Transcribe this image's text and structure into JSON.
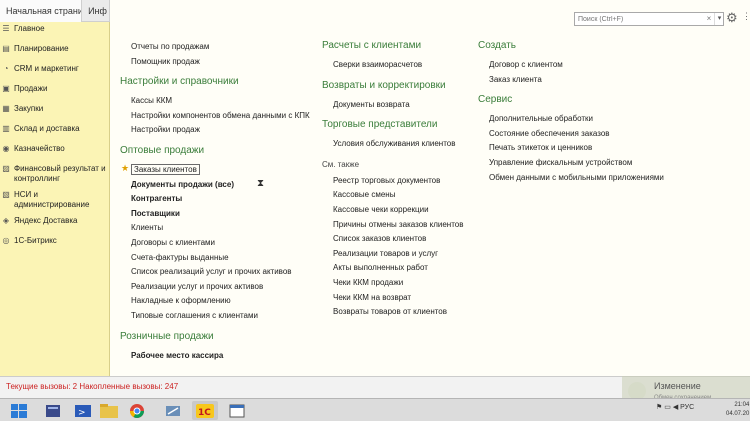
{
  "tabs": [
    {
      "label": "Начальная страница"
    },
    {
      "label": "Инф"
    }
  ],
  "sidebar": {
    "items": [
      {
        "label": "Главное",
        "icon": "menu-icon"
      },
      {
        "label": "Планирование",
        "icon": "planning-icon"
      },
      {
        "label": "CRM и маркетинг",
        "icon": "crm-icon"
      },
      {
        "label": "Продажи",
        "icon": "sales-icon"
      },
      {
        "label": "Закупки",
        "icon": "purchases-icon"
      },
      {
        "label": "Склад и доставка",
        "icon": "warehouse-icon"
      },
      {
        "label": "Казначейство",
        "icon": "treasury-icon"
      },
      {
        "label": "Финансовый результат и контроллинг",
        "icon": "finance-icon"
      },
      {
        "label": "НСИ и администрирование",
        "icon": "admin-icon"
      },
      {
        "label": "Яндекс Доставка",
        "icon": "yandex-icon"
      },
      {
        "label": "1С-Битрикс",
        "icon": "bitrix-icon"
      }
    ]
  },
  "search": {
    "placeholder": "Поиск (Ctrl+F)",
    "clear": "×",
    "dropdown": "▾"
  },
  "col1": {
    "top_links": [
      "Отчеты по продажам",
      "Помощник продаж"
    ],
    "settings_title": "Настройки и справочники",
    "settings_links": [
      "Кассы ККМ",
      "Настройки компонентов обмена данными с КПК",
      "Настройки продаж"
    ],
    "wholesale_title": "Оптовые продажи",
    "wholesale_links": [
      {
        "label": "Заказы клиентов"
      },
      {
        "label": "Документы продажи (все)"
      },
      {
        "label": "Контрагенты"
      },
      {
        "label": "Поставщики"
      },
      {
        "label": "Клиенты"
      },
      {
        "label": "Договоры с клиентами"
      },
      {
        "label": "Счета-фактуры выданные"
      },
      {
        "label": "Список реализаций услуг и прочих активов"
      },
      {
        "label": "Реализации услуг и прочих активов"
      },
      {
        "label": "Накладные к оформлению"
      },
      {
        "label": "Типовые соглашения с клиентами"
      }
    ],
    "retail_title": "Розничные продажи",
    "retail_links": [
      "Рабочее место кассира"
    ]
  },
  "col2": {
    "settlements_title": "Расчеты с клиентами",
    "settlements_links": [
      "Сверки взаиморасчетов"
    ],
    "returns_title": "Возвраты и корректировки",
    "returns_links": [
      "Документы возврата"
    ],
    "agents_title": "Торговые представители",
    "agents_links": [
      "Условия обслуживания клиентов"
    ],
    "see_also": "См. также",
    "see_also_links": [
      "Реестр торговых документов",
      "Кассовые смены",
      "Кассовые чеки коррекции",
      "Причины отмены заказов клиентов",
      "Список заказов клиентов",
      "Реализации товаров и услуг",
      "Акты выполненных работ",
      "Чеки ККМ продажи",
      "Чеки ККМ на возврат",
      "Возвраты товаров от клиентов"
    ]
  },
  "col3": {
    "create_title": "Создать",
    "create_links": [
      "Договор с клиентом",
      "Заказ клиента"
    ],
    "service_title": "Сервис",
    "service_links": [
      "Дополнительные обработки",
      "Состояние обеспечения заказов",
      "Печать этикеток и ценников",
      "Управление фискальным устройством",
      "Обмен данными с мобильными приложениями"
    ]
  },
  "status": {
    "text": "Текущие вызовы: 2   Накопленные вызовы: 247"
  },
  "toast": {
    "title": "Изменение",
    "subtitle": "Обмен сохранением"
  },
  "taskbar": {
    "lang": "РУС",
    "time": "21:04",
    "date": "04.07.20"
  },
  "colors": {
    "sidebar_bg": "#fbf4b5",
    "heading_green": "#3a7d3a",
    "status_red": "#cc2222"
  }
}
